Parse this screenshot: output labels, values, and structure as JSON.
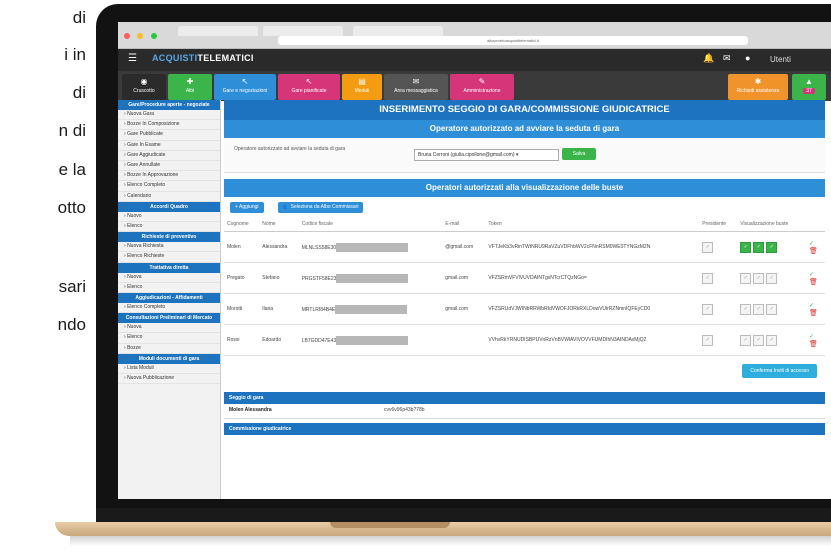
{
  "side_text": [
    "di",
    "i in",
    "di",
    "n di",
    "e la",
    "otto",
    "sari",
    "ndo"
  ],
  "browser": {
    "url": "altovenetoacquistitelematici.it"
  },
  "topbar": {
    "logo_a": "ACQUISTI",
    "logo_b": "TELEMATICI",
    "user": "Utenti"
  },
  "tiles": [
    {
      "label": "Cruscotto",
      "icon": "dashboard-icon",
      "color": "#2b2b2b"
    },
    {
      "label": "Albi",
      "icon": "albi-icon",
      "color": "#3bb54a"
    },
    {
      "label": "Gare e negoziazioni",
      "icon": "gare-icon",
      "color": "#2e8fd8"
    },
    {
      "label": "Gare pianificate",
      "icon": "pianificate-icon",
      "color": "#d6357a"
    },
    {
      "label": "Moduli",
      "icon": "moduli-icon",
      "color": "#f39c12"
    },
    {
      "label": "Area messaggistica",
      "icon": "mail-icon",
      "color": "#555555"
    },
    {
      "label": "Amministrazione",
      "icon": "admin-icon",
      "color": "#d6357a"
    },
    {
      "label": "Richiedi assistenza",
      "icon": "assistenza-icon",
      "color": "#f0932b"
    },
    {
      "label": "37",
      "icon": "badge-icon",
      "color": "#3bb54a"
    }
  ],
  "sidebar": {
    "sections": [
      {
        "title": "Gare/Procedure aperte - negoziate",
        "items": [
          "Nuova Gara",
          "Bozze In Composizione",
          "Gare Pubblicate",
          "Gare In Esame",
          "Gare Aggiudicate",
          "Gare Annullate",
          "Bozze In Approvazione",
          "Elenco Completo",
          "Calendario"
        ]
      },
      {
        "title": "Accordi Quadro",
        "items": [
          "Nuovo",
          "Elenco"
        ]
      },
      {
        "title": "Richieste di preventivo",
        "items": [
          "Nuova Richiesta",
          "Elenco Richieste"
        ]
      },
      {
        "title": "Trattativa diretta",
        "items": [
          "Nuova",
          "Elenco"
        ]
      },
      {
        "title": "Aggiudicazioni - Affidamenti",
        "items": [
          "Elenco Completo"
        ]
      },
      {
        "title": "Consultazioni Preliminari di Mercato",
        "items": [
          "Nuova",
          "Elenco",
          "Bozze"
        ]
      },
      {
        "title": "Moduli documenti di gara",
        "items": [
          "Lista Moduli",
          "Nuova Pubblicazione"
        ]
      }
    ]
  },
  "main": {
    "title": "INSERIMENTO SEGGIO DI GARA/COMMISSIONE GIUDICATRICE",
    "operator_bar": "Operatore autorizzato ad avviare la seduta di gara",
    "operator_label": "Operatore autorizzato ad avviare la seduta di gara",
    "operator_value": "Bruna Cerroni (giulia.cipollone@gmail.com)",
    "save_label": "Salva",
    "authorized_bar": "Operatori autorizzati alla visualizzazione delle buste",
    "add_label": "+ Aggiungi",
    "select_label": "Seleziona da Albo Commissari",
    "columns": [
      "Cognome",
      "Nome",
      "Codice fiscale",
      "E-mail",
      "Token",
      "Presidente",
      "Visualizzazione buste",
      ""
    ],
    "rows": [
      {
        "cognome": "Molen",
        "nome": "Alessandra",
        "cf": "MLNLSS58E30",
        "email": "@gmail.com",
        "token": "VFTJeKb3vRinTWtNRU9RaVZuVDFhbWV2cFNnRSM0WE0TYNGzM2N",
        "presidente": false,
        "visual": [
          true,
          true,
          true
        ]
      },
      {
        "cognome": "Pregato",
        "nome": "Stefano",
        "cf": "PRGSTF58E23",
        "email": "gmail.com",
        "token": "VFZSRmVFVlVUVDAINTgvNTcrCTQzNGo=",
        "presidente": false,
        "visual": [
          false,
          false,
          false
        ]
      },
      {
        "cognome": "Morotti",
        "nome": "Ilaria",
        "cf": "MRTLRI84B4E",
        "email": "gmail.com",
        "token": "VFZSRUdVJWINbRRWbRIdVWOFJORkRXLDowVUlrRZNmnIQFEyCD0",
        "presidente": false,
        "visual": [
          false,
          false,
          false
        ]
      },
      {
        "cognome": "Rossi",
        "nome": "Edoardo",
        "cf": "LB7GDD47E43",
        "email": "",
        "token": "VVhvRkYRNUDISBPUVnRzVnBVWlAVIVOVVFUMDIhN3AINDAvMjQ2",
        "presidente": false,
        "visual": [
          false,
          false,
          false
        ]
      }
    ],
    "conferma_label": "Conferma Inviti di accesso",
    "seggio_title": "Seggio di gara",
    "seggio_name": "Molen Alessandra",
    "seggio_code": "cvv6v96p43b?78b",
    "commissione_title": "Commissione giudicatrice"
  }
}
